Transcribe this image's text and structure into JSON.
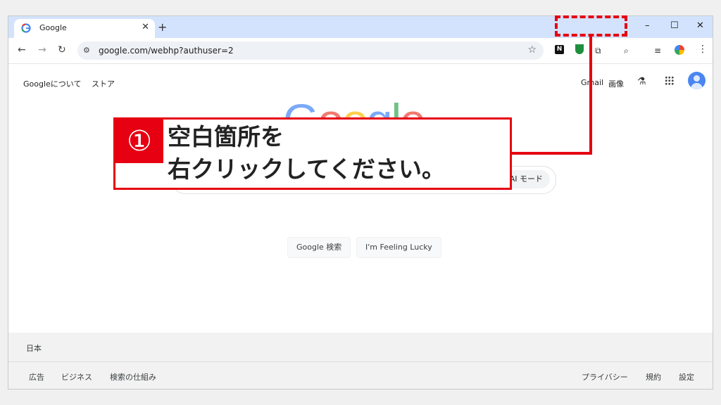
{
  "tab": {
    "title": "Google",
    "close": "✕",
    "new": "+"
  },
  "window_controls": {
    "minimize": "–",
    "maximize": "☐",
    "close": "✕"
  },
  "nav": {
    "back": "←",
    "forward": "→",
    "reload": "↻"
  },
  "omnibox": {
    "url": "google.com/webhp?authuser=2",
    "star": "☆"
  },
  "extensions": {
    "notion": "N"
  },
  "google": {
    "about": "Googleについて",
    "store": "ストア",
    "gmail": "Gmail",
    "images": "画像",
    "logo": [
      "G",
      "o",
      "o",
      "g",
      "l",
      "e"
    ],
    "logo_colors": [
      "#4285f4",
      "#ea4335",
      "#fbbc05",
      "#4285f4",
      "#34a853",
      "#ea4335"
    ],
    "ai_mode": "AI モード",
    "search_button": "Google 検索",
    "lucky_button": "I'm Feeling Lucky"
  },
  "footer": {
    "country": "日本",
    "left_links": [
      "広告",
      "ビジネス",
      "検索の仕組み"
    ],
    "right_links": [
      "プライバシー",
      "規約",
      "設定"
    ]
  },
  "annotation": {
    "number": "①",
    "line1": "空白箇所を",
    "line2": "右クリックしてください。",
    "color": "#e60012"
  }
}
